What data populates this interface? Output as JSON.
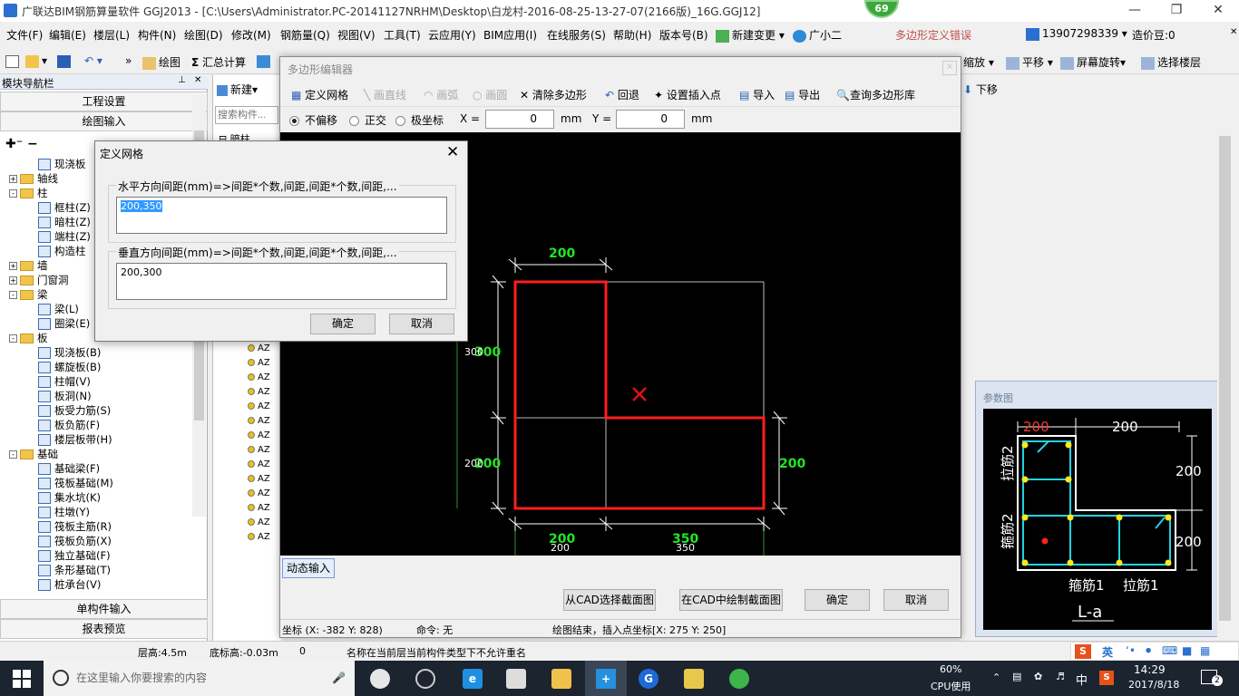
{
  "window": {
    "title": "广联达BIM钢筋算量软件 GGJ2013 - [C:\\Users\\Administrator.PC-20141127NRHM\\Desktop\\白龙村-2016-08-25-13-27-07(2166版)_16G.GGJ12]",
    "badge": "69"
  },
  "menubar": {
    "items": [
      "文件(F)",
      "编辑(E)",
      "楼层(L)",
      "构件(N)",
      "绘图(D)",
      "修改(M)",
      "钢筋量(Q)",
      "视图(V)",
      "工具(T)",
      "云应用(Y)",
      "BIM应用(I)",
      "在线服务(S)",
      "帮助(H)",
      "版本号(B)",
      "新建变更",
      "广小二"
    ],
    "error": "多边形定义错误",
    "phone": "13907298339",
    "price": "造价豆:0"
  },
  "toolbar": {
    "draw": "绘图",
    "sum": "汇总计算",
    "zoom": "缩放",
    "pan": "平移",
    "rotate": "屏幕旋转",
    "select_floor": "选择楼层",
    "new": "新建",
    "search_placeholder": "搜索构件...",
    "down": "下移"
  },
  "leftpanel": {
    "header": "模块导航栏",
    "btn1": "工程设置",
    "btn2": "绘图输入",
    "btn3": "单构件输入",
    "btn4": "报表预览",
    "tree": [
      {
        "t": "现浇板",
        "lv": 2,
        "k": "n"
      },
      {
        "t": "轴线",
        "lv": 1,
        "k": "f",
        "g": "+"
      },
      {
        "t": "柱",
        "lv": 1,
        "k": "f",
        "g": "-"
      },
      {
        "t": "框柱(Z)",
        "lv": 2,
        "k": "n"
      },
      {
        "t": "暗柱(Z)",
        "lv": 2,
        "k": "n"
      },
      {
        "t": "端柱(Z)",
        "lv": 2,
        "k": "n"
      },
      {
        "t": "构造柱",
        "lv": 2,
        "k": "n"
      },
      {
        "t": "墙",
        "lv": 1,
        "k": "f",
        "g": "+"
      },
      {
        "t": "门窗洞",
        "lv": 1,
        "k": "f",
        "g": "+"
      },
      {
        "t": "梁",
        "lv": 1,
        "k": "f",
        "g": "-"
      },
      {
        "t": "梁(L)",
        "lv": 2,
        "k": "n"
      },
      {
        "t": "圈梁(E)",
        "lv": 2,
        "k": "n"
      },
      {
        "t": "板",
        "lv": 1,
        "k": "f",
        "g": "-"
      },
      {
        "t": "现浇板(B)",
        "lv": 2,
        "k": "n"
      },
      {
        "t": "螺旋板(B)",
        "lv": 2,
        "k": "n"
      },
      {
        "t": "柱帽(V)",
        "lv": 2,
        "k": "n"
      },
      {
        "t": "板洞(N)",
        "lv": 2,
        "k": "n"
      },
      {
        "t": "板受力筋(S)",
        "lv": 2,
        "k": "n"
      },
      {
        "t": "板负筋(F)",
        "lv": 2,
        "k": "n"
      },
      {
        "t": "楼层板带(H)",
        "lv": 2,
        "k": "n"
      },
      {
        "t": "基础",
        "lv": 1,
        "k": "f",
        "g": "-"
      },
      {
        "t": "基础梁(F)",
        "lv": 2,
        "k": "n"
      },
      {
        "t": "筏板基础(M)",
        "lv": 2,
        "k": "n"
      },
      {
        "t": "集水坑(K)",
        "lv": 2,
        "k": "n"
      },
      {
        "t": "柱墩(Y)",
        "lv": 2,
        "k": "n"
      },
      {
        "t": "筏板主筋(R)",
        "lv": 2,
        "k": "n"
      },
      {
        "t": "筏板负筋(X)",
        "lv": 2,
        "k": "n"
      },
      {
        "t": "独立基础(F)",
        "lv": 2,
        "k": "n"
      },
      {
        "t": "条形基础(T)",
        "lv": 2,
        "k": "n"
      },
      {
        "t": "桩承台(V)",
        "lv": 2,
        "k": "n"
      }
    ]
  },
  "midpanel": {
    "top_item": "暗柱",
    "item": "AZ"
  },
  "poly": {
    "title": "多边形编辑器",
    "define_grid": "定义网格",
    "draw_line": "画直线",
    "draw_arc": "画弧",
    "draw_circle": "画圆",
    "clear": "清除多边形",
    "undo": "回退",
    "set_insert": "设置插入点",
    "import": "导入",
    "export": "导出",
    "query": "查询多边形库",
    "mode_none": "不偏移",
    "mode_ortho": "正交",
    "mode_polar": "极坐标",
    "x_label": "X =",
    "x_val": "0",
    "y_label": "Y =",
    "y_val": "0",
    "unit": "mm",
    "dyn": "动态输入",
    "btn_cad_select": "从CAD选择截面图",
    "btn_cad_draw": "在CAD中绘制截面图",
    "ok": "确定",
    "cancel": "取消",
    "status_coord": "坐标 (X: -382 Y: 828)",
    "status_cmd": "命令: 无",
    "status_msg": "绘图结束，插入点坐标[X: 275 Y: 250]"
  },
  "canvas": {
    "top_dim": "200",
    "left_upper": "300",
    "left_upper_w": "300",
    "left_lower": "200",
    "left_lower_w": "200",
    "right_dim": "200",
    "bottom_left": "200",
    "bottom_left_w": "200",
    "bottom_right": "350",
    "bottom_right_w": "350"
  },
  "dialog": {
    "title": "定义网格",
    "h_label": "水平方向间距(mm)=>间距*个数,间距,间距*个数,间距,...",
    "h_value": "200,350",
    "v_label": "垂直方向间距(mm)=>间距*个数,间距,间距*个数,间距,...",
    "v_value": "200,300",
    "ok": "确定",
    "cancel": "取消"
  },
  "params": {
    "title": "参数图",
    "dim_top_left": "200",
    "dim_top_right": "200",
    "dim_right_upper": "200",
    "dim_right_lower": "200",
    "lbl_tie2_top": "拉筋2",
    "lbl_stir2": "箍筋2",
    "lbl_stir1": "箍筋1",
    "lbl_tie1": "拉筋1",
    "name": "L-a"
  },
  "statusbar": {
    "floor_h": "层高:4.5m",
    "base_h": "底标高:-0.03m",
    "zero": "0",
    "msg": "名称在当前层当前构件类型下不允许重名"
  },
  "ime": {
    "lang": "英"
  },
  "taskbar": {
    "search": "在这里输入你要搜索的内容",
    "cpu": "60%",
    "cpu_label": "CPU使用",
    "ime": "中",
    "time": "14:29",
    "date": "2017/8/18",
    "notif": "2"
  }
}
